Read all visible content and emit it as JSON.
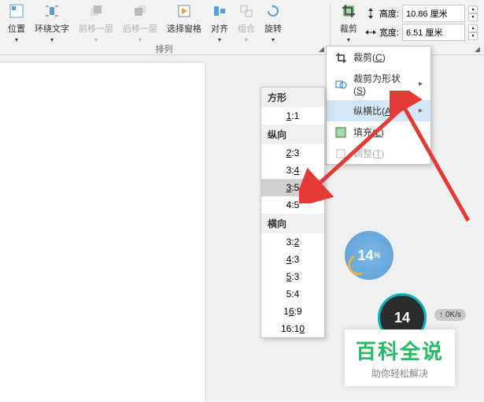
{
  "ribbon": {
    "position": "位置",
    "wrap_text": "环绕文字",
    "bring_forward": "前移一层",
    "send_backward": "后移一层",
    "selection_pane": "选择窗格",
    "align": "对齐",
    "group": "组合",
    "rotate": "旋转",
    "crop": "裁剪",
    "arrange_label": "排列",
    "height_label": "高度:",
    "width_label": "宽度:",
    "height_value": "10.86 厘米",
    "width_value": "6.51 厘米"
  },
  "crop_menu": {
    "crop": "裁剪",
    "crop_shortcut": "C",
    "crop_to_shape": "裁剪为形状",
    "crop_to_shape_shortcut": "S",
    "aspect_ratio": "纵横比",
    "aspect_ratio_shortcut": "A",
    "fill": "填充",
    "fill_shortcut": "L",
    "fit": "调整",
    "fit_shortcut": "T"
  },
  "ratio_menu": {
    "square_header": "方形",
    "square_items": [
      "1:1"
    ],
    "portrait_header": "纵向",
    "portrait_items": [
      "2:3",
      "3:4",
      "3:5",
      "4:5"
    ],
    "landscape_header": "横向",
    "landscape_items": [
      "3:2",
      "4:3",
      "5:3",
      "5:4",
      "16:9",
      "16:10"
    ]
  },
  "widgets": {
    "circ1_value": "14",
    "circ1_pct": "%",
    "circ2_value": "14",
    "net_speed": "0K/s"
  },
  "watermark": {
    "title": "百科全说",
    "sub": "助你轻松解决"
  }
}
